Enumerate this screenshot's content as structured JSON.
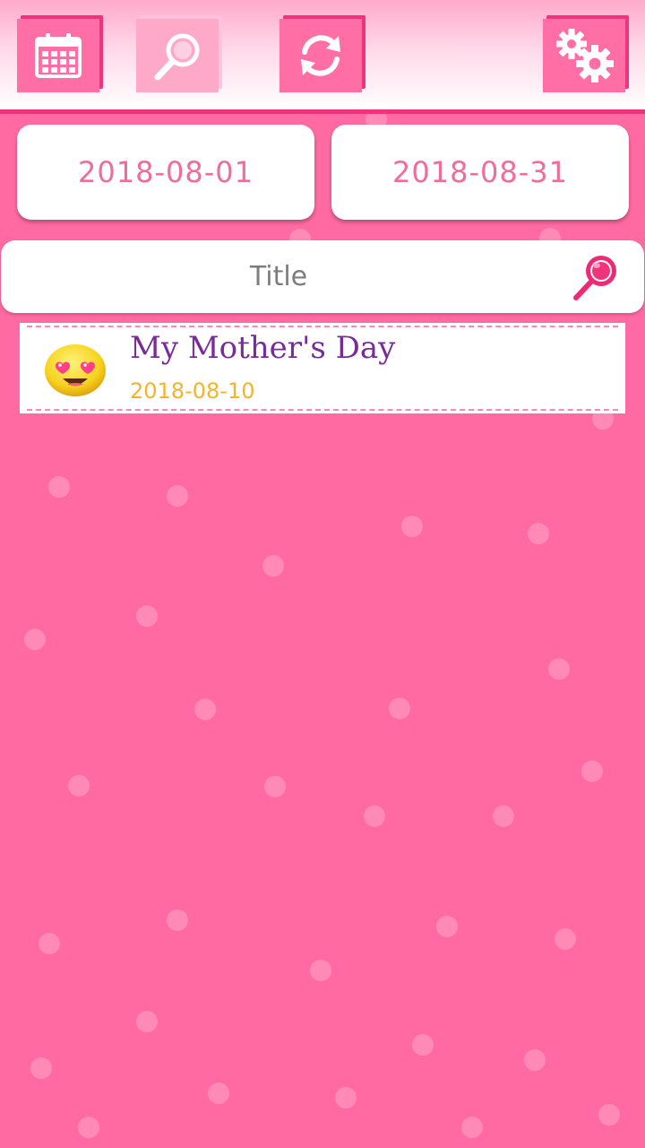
{
  "toolbar": {
    "buttons": [
      {
        "icon": "calendar-icon"
      },
      {
        "icon": "search-icon",
        "active": true
      },
      {
        "icon": "refresh-icon"
      },
      {
        "icon": "settings-icon"
      }
    ]
  },
  "filter": {
    "start_date": "2018-08-01",
    "end_date": "2018-08-31",
    "search_placeholder": "Title",
    "search_value": ""
  },
  "entries": [
    {
      "title": "My Mother's Day",
      "date": "2018-08-10",
      "mood_icon": "heart-eyes-emoji-icon"
    }
  ],
  "colors": {
    "background": "#ff6aa2",
    "accent": "#f0347b",
    "date_text": "#ef6d98",
    "entry_title": "#7a2b9a",
    "entry_date": "#f3b42c"
  }
}
